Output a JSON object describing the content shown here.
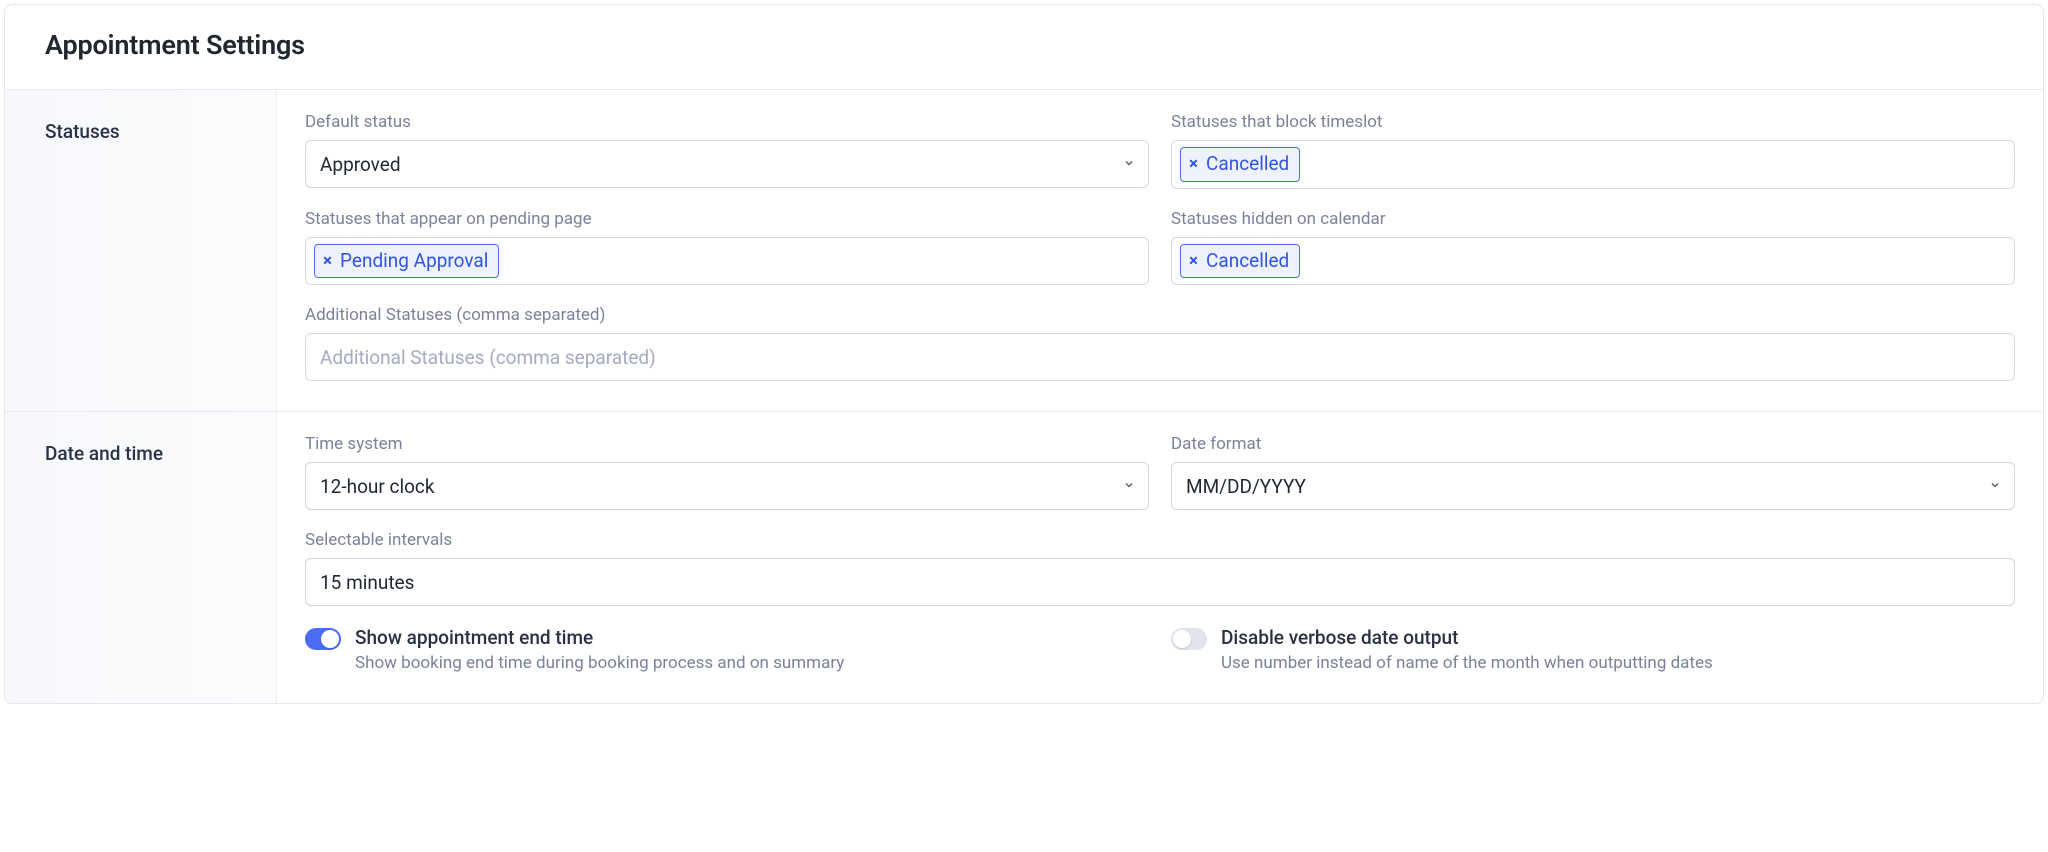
{
  "title": "Appointment Settings",
  "statuses": {
    "section_label": "Statuses",
    "default_status": {
      "label": "Default status",
      "value": "Approved"
    },
    "block_timeslot": {
      "label": "Statuses that block timeslot",
      "tags": [
        "Cancelled"
      ]
    },
    "pending_page": {
      "label": "Statuses that appear on pending page",
      "tags": [
        "Pending Approval"
      ]
    },
    "hidden_calendar": {
      "label": "Statuses hidden on calendar",
      "tags": [
        "Cancelled"
      ]
    },
    "additional": {
      "label": "Additional Statuses (comma separated)",
      "placeholder": "Additional Statuses (comma separated)",
      "value": ""
    }
  },
  "datetime": {
    "section_label": "Date and time",
    "time_system": {
      "label": "Time system",
      "value": "12-hour clock"
    },
    "date_format": {
      "label": "Date format",
      "value": "MM/DD/YYYY"
    },
    "intervals": {
      "label": "Selectable intervals",
      "value": "15 minutes"
    },
    "show_end_time": {
      "title": "Show appointment end time",
      "sub": "Show booking end time during booking process and on summary",
      "on": true
    },
    "disable_verbose": {
      "title": "Disable verbose date output",
      "sub": "Use number instead of name of the month when outputting dates",
      "on": false
    }
  }
}
